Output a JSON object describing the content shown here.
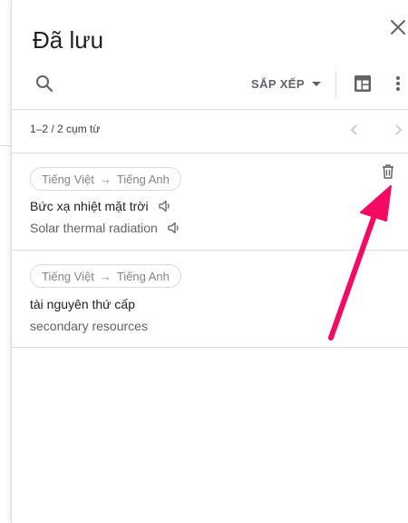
{
  "panel": {
    "title": "Đã lưu"
  },
  "toolbar": {
    "sort_label": "SẮP XẾP"
  },
  "pagination": {
    "range_text": "1–2 / 2 cụm từ"
  },
  "phrases": [
    {
      "language_pair": {
        "source": "Tiếng Việt",
        "arrow": "→",
        "target": "Tiếng Anh"
      },
      "source_text": "Bức xạ nhiệt mặt trời",
      "translated_text": "Solar thermal radiation"
    },
    {
      "language_pair": {
        "source": "Tiếng Việt",
        "arrow": "→",
        "target": "Tiếng Anh"
      },
      "source_text": "tài nguyên thứ cấp",
      "translated_text": "secondary resources"
    }
  ],
  "icons": {
    "close": "close-icon",
    "search": "search-icon",
    "sort_caret": "caret-down-icon",
    "sheets": "sheets-icon",
    "more": "more-vert-icon",
    "prev": "chevron-left-icon",
    "next": "chevron-right-icon",
    "speaker": "volume-icon",
    "delete": "trash-icon"
  },
  "colors": {
    "text_primary": "#202124",
    "text_secondary": "#5f6368",
    "chip_text": "#80868b",
    "divider": "#dadce0",
    "annotation_arrow": "#f50a63"
  }
}
